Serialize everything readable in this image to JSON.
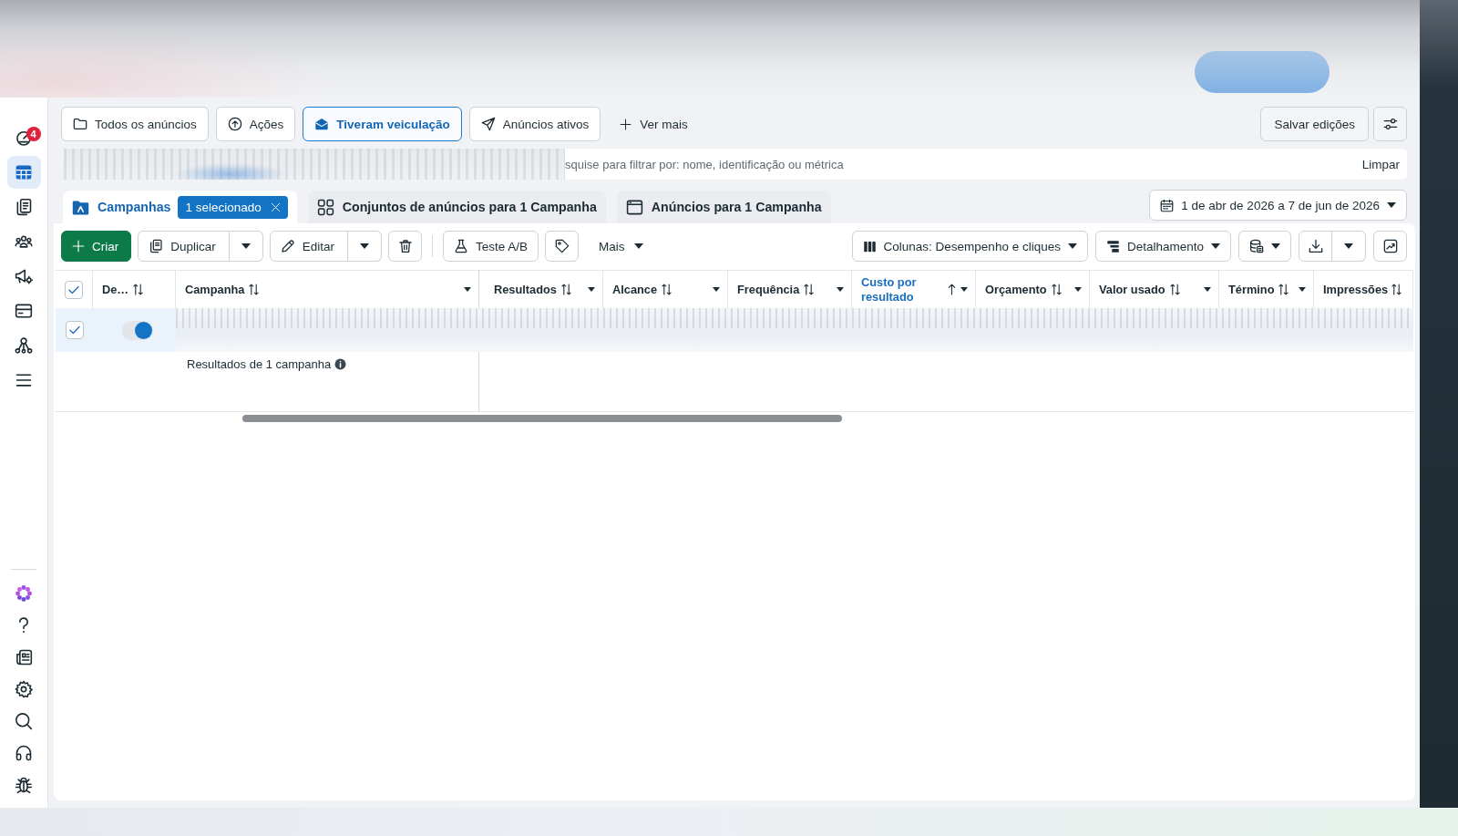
{
  "sidebar": {
    "top_items": [
      {
        "kind": "alerts",
        "selected": false,
        "badge": "4"
      },
      {
        "kind": "table",
        "selected": true
      },
      {
        "kind": "documents",
        "selected": false
      },
      {
        "kind": "audiences",
        "selected": false
      },
      {
        "kind": "campaigns",
        "selected": false
      },
      {
        "kind": "billing",
        "selected": false
      },
      {
        "kind": "network",
        "selected": false
      },
      {
        "kind": "menu",
        "selected": false
      }
    ],
    "bottom_items": [
      {
        "kind": "logo",
        "selected": false
      },
      {
        "kind": "help",
        "selected": false
      },
      {
        "kind": "news",
        "selected": false
      },
      {
        "kind": "settings",
        "selected": false
      },
      {
        "kind": "search",
        "selected": false
      },
      {
        "kind": "support",
        "selected": false
      },
      {
        "kind": "bugs",
        "selected": false
      }
    ]
  },
  "filter_bar": {
    "views": [
      {
        "label": "Todos os anúncios",
        "kind": "all",
        "selected": false
      },
      {
        "label": "Ações",
        "kind": "actions",
        "selected": false
      },
      {
        "label": "Tiveram veiculação",
        "kind": "delivered",
        "selected": true
      },
      {
        "label": "Anúncios ativos",
        "kind": "active",
        "selected": false
      }
    ],
    "see_more": "Ver mais",
    "save_button": "Salvar edições"
  },
  "search": {
    "placeholder": "squise para filtrar por: nome, identificação ou métrica",
    "clear_button": "Limpar"
  },
  "tabs": [
    {
      "label": "Campanhas",
      "kind": "campaigns",
      "selected": true,
      "badge": "1 selecionado"
    },
    {
      "label": "Conjuntos de anúncios para 1 Campanha",
      "kind": "adsets",
      "selected": false
    },
    {
      "label": "Anúncios para 1 Campanha",
      "kind": "ads",
      "selected": false
    }
  ],
  "date_range": "1 de abr de 2026 a 7 de jun de 2026",
  "toolbar": {
    "create_button": "Criar",
    "duplicate_button": "Duplicar",
    "edit_button": "Editar",
    "ab_test_button": "Teste A/B",
    "more_button": "Mais",
    "columns_button": "Colunas: Desempenho e cliques",
    "breakdown_button": "Detalhamento"
  },
  "table": {
    "header_checked": true,
    "columns": [
      {
        "label": "De…",
        "sorted": false,
        "menu": false
      },
      {
        "label": "Campanha",
        "sorted": false,
        "menu": true
      },
      {
        "label": "Resultados",
        "sorted": false,
        "menu": true
      },
      {
        "label": "Alcance",
        "sorted": false,
        "menu": true
      },
      {
        "label": "Frequência",
        "sorted": false,
        "menu": true
      },
      {
        "label": "Custo por resultado",
        "sorted": true,
        "menu": true
      },
      {
        "label": "Orçamento",
        "sorted": false,
        "menu": true
      },
      {
        "label": "Valor usado",
        "sorted": false,
        "menu": true
      },
      {
        "label": "Término",
        "sorted": false,
        "menu": true
      },
      {
        "label": "Impressões",
        "sorted": false,
        "menu": false
      }
    ],
    "rows": [
      {
        "checked": true,
        "on": true
      }
    ],
    "summary": "Resultados de 1 campanha"
  }
}
